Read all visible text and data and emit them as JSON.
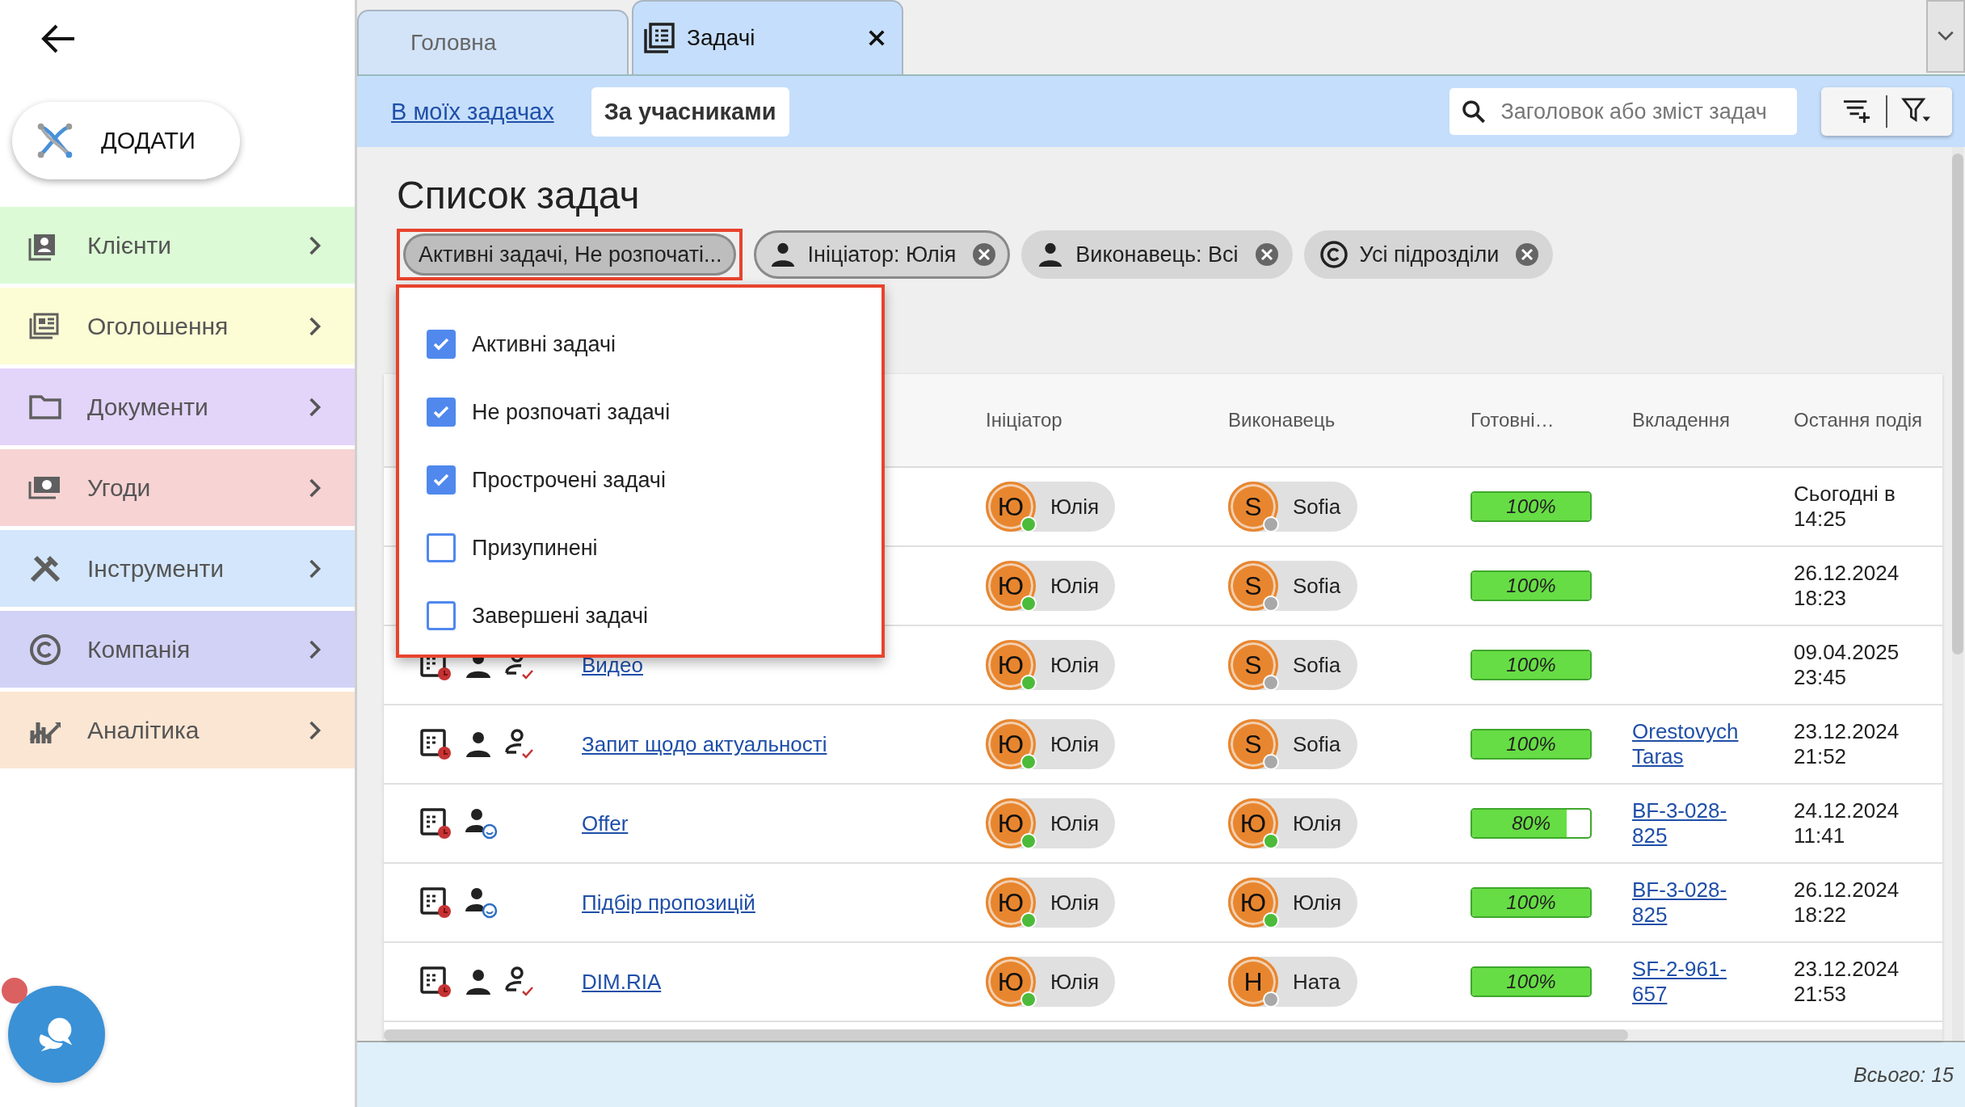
{
  "sidebar": {
    "add_button": "ДОДАТИ",
    "items": [
      {
        "kind": "clients",
        "label": "Клієнти",
        "color": "#dbfad5"
      },
      {
        "kind": "ads",
        "label": "Оголошення",
        "color": "#fcfcd5"
      },
      {
        "kind": "documents",
        "label": "Документи",
        "color": "#e3d4fa"
      },
      {
        "kind": "deals",
        "label": "Угоди",
        "color": "#f7d3d3"
      },
      {
        "kind": "tools",
        "label": "Інструменти",
        "color": "#d4e6fb"
      },
      {
        "kind": "company",
        "label": "Компанія",
        "color": "#d2d2f7"
      },
      {
        "kind": "analytics",
        "label": "Аналітика",
        "color": "#fbe6d3"
      }
    ]
  },
  "tabs": [
    {
      "label": "Головна",
      "selected": false
    },
    {
      "label": "Задачі",
      "selected": true
    }
  ],
  "toolbar": {
    "views": [
      {
        "label": "В моїх задачах",
        "selected": false
      },
      {
        "label": "За учасниками",
        "selected": true
      }
    ],
    "search": {
      "placeholder": "Заголовок або зміст задач"
    }
  },
  "title": "Список задач",
  "filters": [
    {
      "kind": "dropdown",
      "label": "Активні задачі, Не розпочаті...",
      "outlined": false,
      "expanded": true
    },
    {
      "kind": "person",
      "label": "Ініціатор: Юлія",
      "outlined": true,
      "expanded": false
    },
    {
      "kind": "person",
      "label": "Виконавець: Всі",
      "outlined": false,
      "expanded": false
    },
    {
      "kind": "company",
      "label": "Усі підрозділи",
      "outlined": false,
      "expanded": false
    }
  ],
  "status_menu": [
    {
      "label": "Активні задачі",
      "checked": true
    },
    {
      "label": "Не розпочаті задачі",
      "checked": true
    },
    {
      "label": "Прострочені задачі",
      "checked": true
    },
    {
      "label": "Призупинені",
      "checked": false
    },
    {
      "label": "Завершені задачі",
      "checked": false
    }
  ],
  "table": {
    "columns": [
      "Ініціатор",
      "Виконавець",
      "Готовні…",
      "Вкладення",
      "Остання подія"
    ],
    "rows": [
      {
        "initiator": {
          "initial": "Ю",
          "name": "Юлія",
          "online": true
        },
        "executor": {
          "initial": "S",
          "name": "Sofia",
          "online": false
        },
        "progress": {
          "level": 1,
          "text": "100%"
        },
        "last_event": "Сьогодні в 14:25"
      },
      {
        "initiator": {
          "initial": "Ю",
          "name": "Юлія",
          "online": true
        },
        "executor": {
          "initial": "S",
          "name": "Sofia",
          "online": false
        },
        "progress": {
          "level": 1,
          "text": "100%"
        },
        "last_event": "26.12.2024 18:23"
      },
      {
        "icons": [
          {
            "kind": "task"
          },
          {
            "kind": "person"
          },
          {
            "kind": "assignee"
          }
        ],
        "title": "Видео",
        "initiator": {
          "initial": "Ю",
          "name": "Юлія",
          "online": true
        },
        "executor": {
          "initial": "S",
          "name": "Sofia",
          "online": false
        },
        "progress": {
          "level": 1,
          "text": "100%"
        },
        "last_event": "09.04.2025 23:45"
      },
      {
        "icons": [
          {
            "kind": "task"
          },
          {
            "kind": "person"
          },
          {
            "kind": "assignee"
          }
        ],
        "title": "Запит щодо актуальності",
        "initiator": {
          "initial": "Ю",
          "name": "Юлія",
          "online": true
        },
        "executor": {
          "initial": "S",
          "name": "Sofia",
          "online": false
        },
        "progress": {
          "level": 1,
          "text": "100%"
        },
        "attachment": "Orestovych Taras",
        "last_event": "23.12.2024 21:52"
      },
      {
        "icons": [
          {
            "kind": "task"
          },
          {
            "kind": "watcher"
          }
        ],
        "title": "Offer",
        "initiator": {
          "initial": "Ю",
          "name": "Юлія",
          "online": true
        },
        "executor": {
          "initial": "Ю",
          "name": "Юлія",
          "online": true
        },
        "progress": {
          "level": 0.8,
          "text": "80%"
        },
        "attachment": "BF-3-028-825",
        "last_event": "24.12.2024 11:41"
      },
      {
        "icons": [
          {
            "kind": "task"
          },
          {
            "kind": "watcher"
          }
        ],
        "title": "Підбір пропозицій",
        "initiator": {
          "initial": "Ю",
          "name": "Юлія",
          "online": true
        },
        "executor": {
          "initial": "Ю",
          "name": "Юлія",
          "online": true
        },
        "progress": {
          "level": 1,
          "text": "100%"
        },
        "attachment": "BF-3-028-825",
        "last_event": "26.12.2024 18:22"
      },
      {
        "icons": [
          {
            "kind": "task"
          },
          {
            "kind": "person"
          },
          {
            "kind": "assignee"
          }
        ],
        "title": "DIM.RIA",
        "initiator": {
          "initial": "Ю",
          "name": "Юлія",
          "online": true
        },
        "executor": {
          "initial": "Н",
          "name": "Ната",
          "online": false
        },
        "progress": {
          "level": 1,
          "text": "100%"
        },
        "attachment": "SF-2-961-657",
        "last_event": "23.12.2024 21:53"
      }
    ]
  },
  "status_bar": "Всього: 15"
}
